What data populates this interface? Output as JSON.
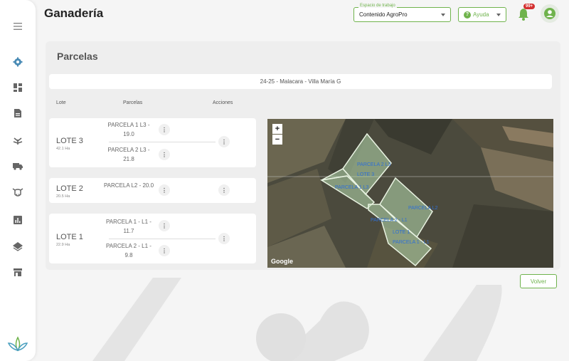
{
  "header": {
    "title": "Ganadería",
    "workspace_legend": "Espacio de trabajo",
    "workspace_value": "Contenido AgroPro",
    "help_label": "Ayuda",
    "notifications_badge": "99+"
  },
  "sidebar": {
    "items": [
      {
        "icon": "gear-icon"
      },
      {
        "icon": "dashboard-icon"
      },
      {
        "icon": "document-icon"
      },
      {
        "icon": "crop-icon"
      },
      {
        "icon": "truck-icon"
      },
      {
        "icon": "cow-icon"
      },
      {
        "icon": "chart-icon"
      },
      {
        "icon": "layers-icon"
      },
      {
        "icon": "store-icon"
      }
    ]
  },
  "parcelas": {
    "title": "Parcelas",
    "campaign": "24-25 - Malacara - Villa María G",
    "columns": {
      "lote": "Lote",
      "parcelas": "Parcelas",
      "acciones": "Acciones"
    },
    "lotes": [
      {
        "name": "LOTE 3",
        "area": "42.1 Ha",
        "parcelas": [
          "PARCELA 1 L3 - 19.0",
          "PARCELA 2 L3 - 21.8"
        ]
      },
      {
        "name": "LOTE 2",
        "area": "20.5 Ha",
        "parcelas": [
          "PARCELA L2 - 20.0"
        ]
      },
      {
        "name": "LOTE 1",
        "area": "22.9 Ha",
        "parcelas": [
          "PARCELA 1 - L1 - 11.7",
          "PARCELA 2 - L1 - 9.8"
        ]
      }
    ]
  },
  "map": {
    "zoom_in": "+",
    "zoom_out": "−",
    "attribution": "Google",
    "labels": [
      "PARCELA 2 L3",
      "LOTE 3",
      "PARCELA 1 L3",
      "PARCELA L2",
      "PARCELA 2 - L1",
      "LOTE 1",
      "PARCELA 1 - L1"
    ]
  },
  "actions": {
    "back": "Volver"
  },
  "colors": {
    "accent": "#6fb34c",
    "badge": "#d32f2f"
  }
}
